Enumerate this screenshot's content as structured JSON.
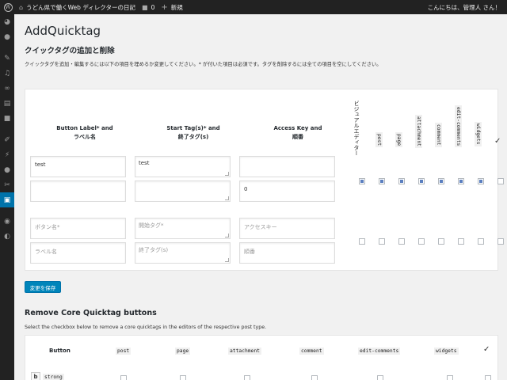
{
  "adminbar": {
    "site_title": "うどん県で働くWeb ディレクターの日記",
    "comments_count": "0",
    "new_label": "新規",
    "howdy": "こんにちは、管理人 さん！"
  },
  "page": {
    "title": "AddQuicktag",
    "section1_title": "クイックタグの追加と削除",
    "section1_desc": "クイックタグを追加・編集するには以下の項目を埋めるか変更してください。* が付いた項目は必須です。タグを削除するには全ての項目を空にしてください。"
  },
  "table": {
    "col_button_label": "Button Label* and",
    "col_button_label2": "ラベル名",
    "col_start_tag": "Start Tag(s)* and",
    "col_start_tag2": "終了タグ(s)",
    "col_access_key": "Access Key and",
    "col_access_key2": "順番",
    "col_visual": "ビジュアルエディター",
    "post_types": [
      "post",
      "page",
      "attachment",
      "comment",
      "edit-comments",
      "widgets"
    ],
    "row1": {
      "label": "test",
      "start_tag": "test",
      "end_tag": "",
      "access_key": "",
      "order": "0",
      "label2": ""
    },
    "row_new": {
      "label_ph": "ボタン名*",
      "label2_ph": "ラベル名",
      "start_ph": "開始タグ*",
      "end_ph": "終了タグ(s)",
      "key_ph": "アクセスキー",
      "order_ph": "順番"
    }
  },
  "save_button": "変更を保存",
  "section2": {
    "title": "Remove Core Quicktag buttons",
    "desc": "Select the checkbox below to remove a core quicktags in the editors of the respective post type.",
    "col_button": "Button",
    "columns": [
      "post",
      "page",
      "attachment",
      "comment",
      "edit-comments",
      "widgets"
    ],
    "row_button": "b",
    "row_tag": "strong"
  }
}
